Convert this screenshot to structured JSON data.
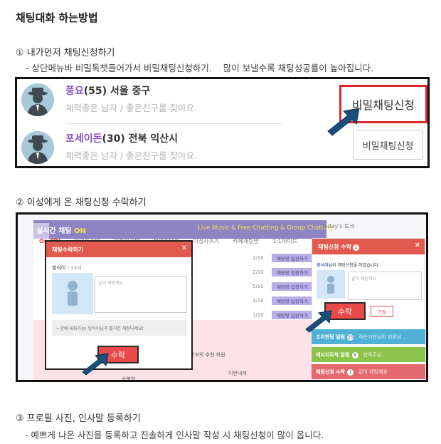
{
  "title": "채팅대화 하는방법",
  "step1": {
    "heading": "① 내가먼저 채팅신청하기",
    "desc": "- 상단메뉴바 비밀톡챗들어가서 비밀채팅신청하기.    많이 보낼수록 채팅성공률이 높아집니다.",
    "profiles": [
      {
        "nick": "풍요",
        "info": "(55) 서울 중구",
        "intro": "체력좋은 남자 / 좋은친구를 찾아요.",
        "button": "비밀채팅신청"
      },
      {
        "nick": "포세이돈",
        "info": "(30) 전북 익산시",
        "intro": "체력좋은 남자 / 좋은친구를 찾아요.",
        "button": "비밀채팅신청"
      }
    ]
  },
  "step2": {
    "heading": "② 이성에게 온 채팅신청 수락하기",
    "banner": {
      "label": "실시간 채팅",
      "on": "ON",
      "sub": "Live Music & Free Chatting & Group Chatting"
    },
    "tabs": [
      "On 채팅",
      "음악듣기방",
      "영화보기방",
      "편안한대화",
      "이성사귀기",
      "카페채팅방",
      "1:1데이트"
    ],
    "rows": [
      {
        "count": "1/10",
        "button": "채팅방 입장하기"
      },
      {
        "count": "2/10",
        "button": "채팅방 입장하기"
      },
      {
        "count": "5/10",
        "button": "채팅방 입장하기"
      },
      {
        "count": "3/10",
        "button": "채팅방 입장하기"
      },
      {
        "count": "1/10",
        "button": "채팅방 입장하기"
      }
    ],
    "today_label": "Today's 토크",
    "modal1": {
      "title": "채팅수락하기",
      "nick": "밤식이",
      "age": "/ 33세",
      "message_placeholder": "같이 채팅해요",
      "notice": "• 밤에 대화가능! 밤식이님과 즐거운 채팅되세요!",
      "accept": "수락"
    },
    "modal2": {
      "title": "채팅신청 수락",
      "badge": "1",
      "requester": "왕식이님",
      "requester_suffix": "이 채팅신청을 하였습니다.",
      "message": "같이 채팅해요",
      "accept": "수락",
      "reject": "거절"
    },
    "notifications": [
      {
        "title": "조이현팅 알림",
        "count": "25",
        "body": "작은거인님이 회원님...",
        "color": "#4fb1d6"
      },
      {
        "title": "애시지도착 알림",
        "count": "8",
        "body": "연락주삼..",
        "color": "#8cc34a"
      },
      {
        "title": "채팅신청 수락",
        "count": "1",
        "body": "같이 채팅해요",
        "color": "#e46a6f"
      }
    ],
    "background_fragments": {
      "recommend": "근처의 추천 회원",
      "member_a": "승봉양",
      "member_b": "이런내게"
    }
  },
  "step3": {
    "heading": "③ 프로필 사진, 인사말 등록하기",
    "desc": "- 예쁘게 나온 사진을 등록하고 진솔하게 인사말 작성 시 채팅선청이 많이 옵니다."
  },
  "colors": {
    "accent_red": "#e0262a",
    "nick_purple": "#8a54c4",
    "arrow_blue": "#1b4e7d",
    "banner_purple": "#8e84c4"
  }
}
